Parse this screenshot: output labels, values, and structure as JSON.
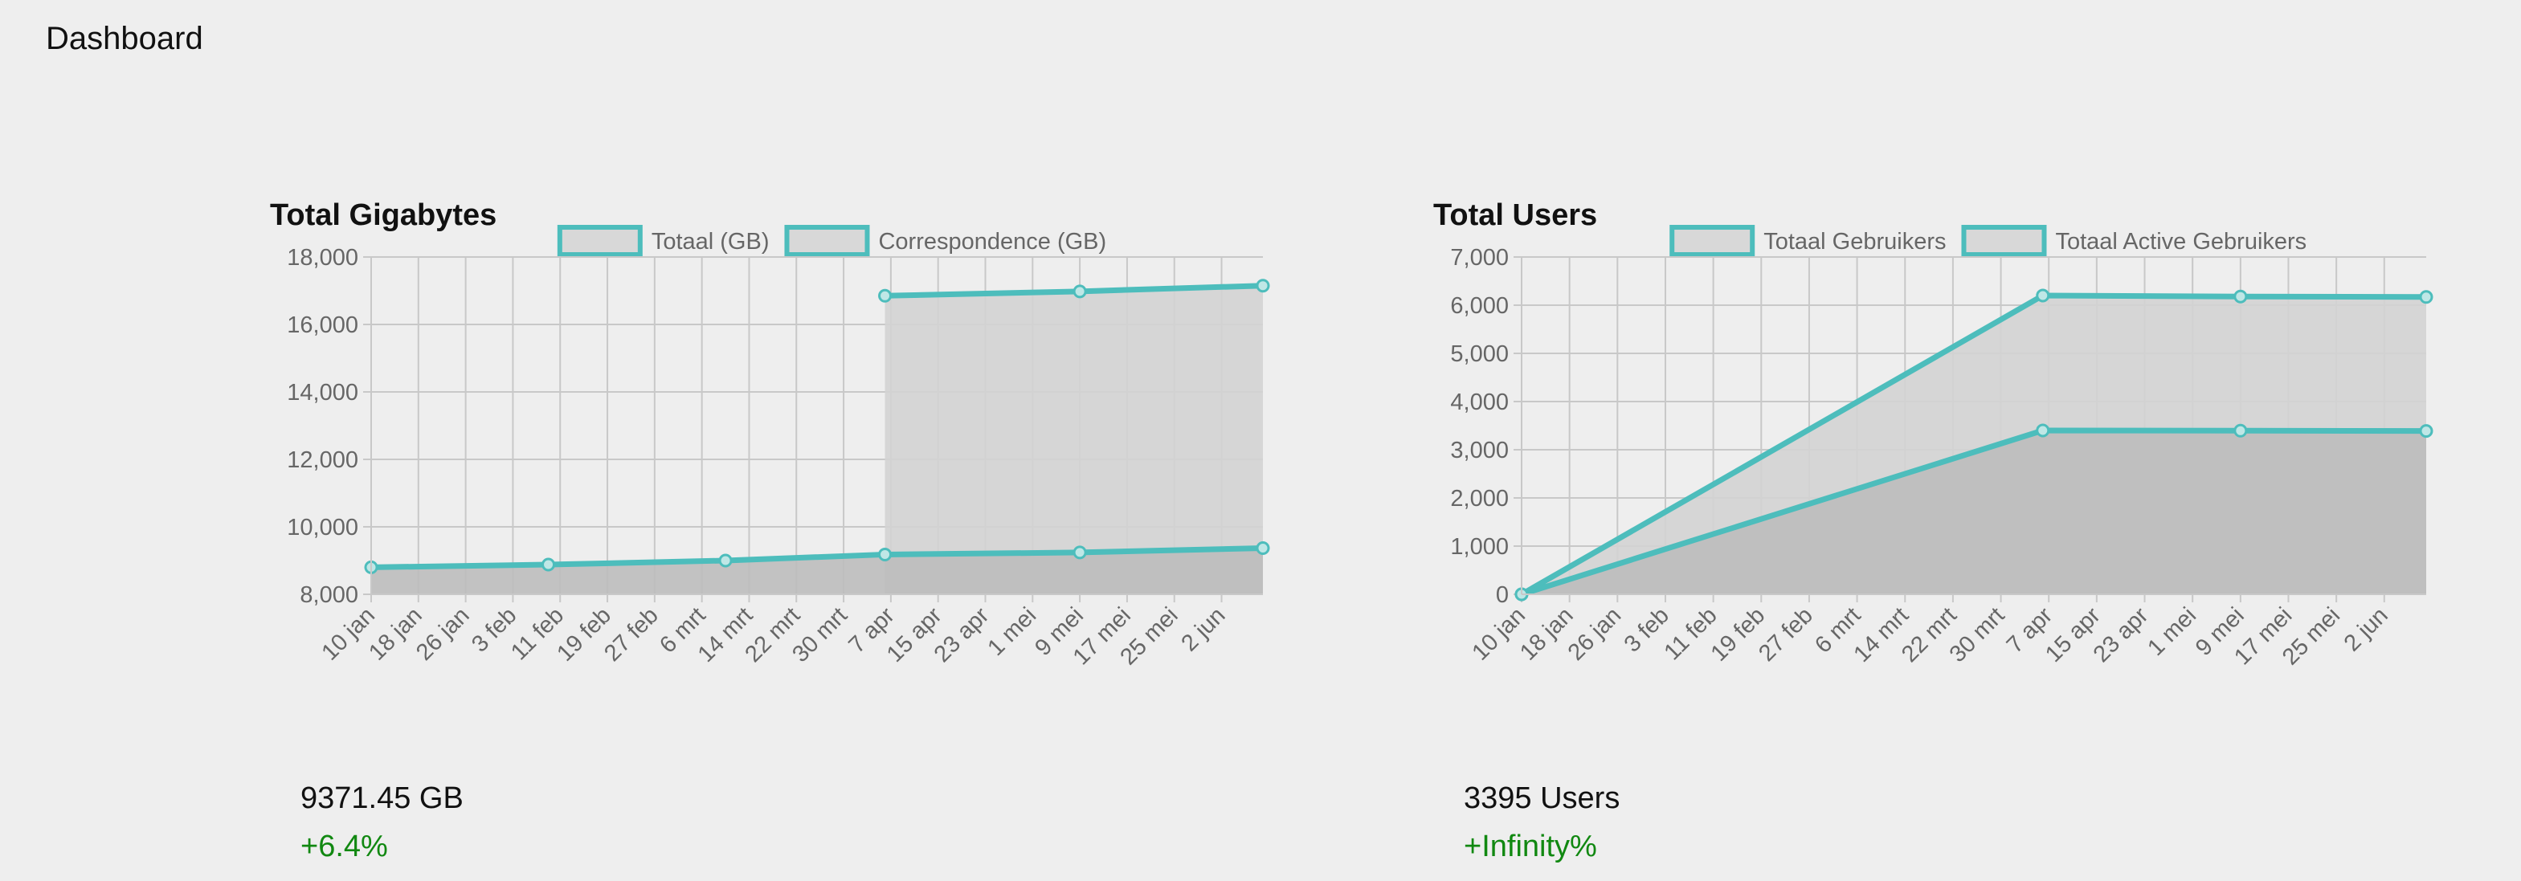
{
  "header": {
    "title": "Dashboard"
  },
  "colors": {
    "line": "#4dbdbc",
    "fill_upper": "#d3d3d3",
    "fill_lower": "#bdbdbd",
    "grid": "#c8c8c8",
    "tick_text": "#666666",
    "positive": "#118811"
  },
  "cards": [
    {
      "title": "Total Gigabytes",
      "summary_value": "9371.45 GB",
      "summary_change": "+6.4%"
    },
    {
      "title": "Total Users",
      "summary_value": "3395 Users",
      "summary_change": "+Infinity%"
    }
  ],
  "chart_data": [
    {
      "type": "area",
      "title": "Total Gigabytes",
      "x_type": "date",
      "x": [
        "10 jan",
        "18 jan",
        "26 jan",
        "3 feb",
        "11 feb",
        "19 feb",
        "27 feb",
        "6 mrt",
        "14 mrt",
        "22 mrt",
        "30 mrt",
        "7 apr",
        "15 apr",
        "23 apr",
        "1 mei",
        "9 mei",
        "17 mei",
        "25 mei",
        "2 jun"
      ],
      "x_range": [
        "2023-01-10",
        "2023-06-10"
      ],
      "ylim": [
        8000,
        18000
      ],
      "yticks": [
        8000,
        10000,
        12000,
        14000,
        16000,
        18000
      ],
      "grid": true,
      "legend_position": "top",
      "series": [
        {
          "name": "Totaal (GB)",
          "points": [
            {
              "date": "2023-04-07",
              "y": 16850
            },
            {
              "date": "2023-05-10",
              "y": 16980
            },
            {
              "date": "2023-06-10",
              "y": 17150
            }
          ]
        },
        {
          "name": "Correspondence (GB)",
          "points": [
            {
              "date": "2023-01-10",
              "y": 8800
            },
            {
              "date": "2023-02-09",
              "y": 8880
            },
            {
              "date": "2023-03-11",
              "y": 9000
            },
            {
              "date": "2023-04-07",
              "y": 9180
            },
            {
              "date": "2023-05-10",
              "y": 9240
            },
            {
              "date": "2023-06-10",
              "y": 9370
            }
          ]
        }
      ]
    },
    {
      "type": "area",
      "title": "Total Users",
      "x_type": "date",
      "x": [
        "10 jan",
        "18 jan",
        "26 jan",
        "3 feb",
        "11 feb",
        "19 feb",
        "27 feb",
        "6 mrt",
        "14 mrt",
        "22 mrt",
        "30 mrt",
        "7 apr",
        "15 apr",
        "23 apr",
        "1 mei",
        "9 mei",
        "17 mei",
        "25 mei",
        "2 jun"
      ],
      "x_range": [
        "2023-01-10",
        "2023-06-10"
      ],
      "ylim": [
        0,
        7000
      ],
      "yticks": [
        0,
        1000,
        2000,
        3000,
        4000,
        5000,
        6000,
        7000
      ],
      "grid": true,
      "legend_position": "top",
      "series": [
        {
          "name": "Totaal Gebruikers",
          "points": [
            {
              "date": "2023-01-10",
              "y": 0
            },
            {
              "date": "2023-04-07",
              "y": 6200
            },
            {
              "date": "2023-05-10",
              "y": 6180
            },
            {
              "date": "2023-06-10",
              "y": 6170
            }
          ]
        },
        {
          "name": "Totaal Active Gebruikers",
          "points": [
            {
              "date": "2023-01-10",
              "y": 0
            },
            {
              "date": "2023-04-07",
              "y": 3400
            },
            {
              "date": "2023-05-10",
              "y": 3395
            },
            {
              "date": "2023-06-10",
              "y": 3390
            }
          ]
        }
      ]
    }
  ]
}
